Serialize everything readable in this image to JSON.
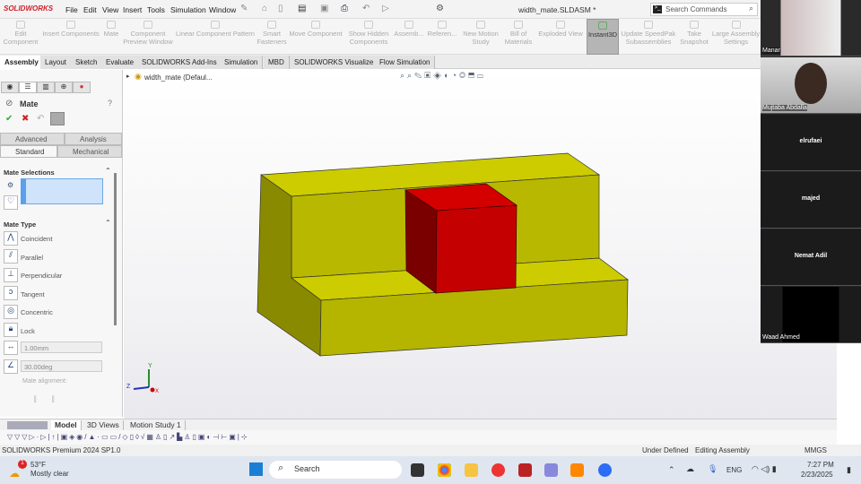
{
  "app": {
    "logo": "SOLIDWORKS",
    "document_title": "width_mate.SLDASM *",
    "search_placeholder": "Search Commands"
  },
  "menu": [
    "File",
    "Edit",
    "View",
    "Insert",
    "Tools",
    "Simulation",
    "Window"
  ],
  "ribbon": [
    {
      "label": "Edit Component"
    },
    {
      "label": "Insert Components"
    },
    {
      "label": "Mate"
    },
    {
      "label": "Component Preview Window"
    },
    {
      "label": "Linear Component Pattern"
    },
    {
      "label": "Smart Fasteners"
    },
    {
      "label": "Move Component"
    },
    {
      "label": "Show Hidden Components"
    },
    {
      "label": "Assemb..."
    },
    {
      "label": "Referen..."
    },
    {
      "label": "New Motion Study"
    },
    {
      "label": "Bill of Materials"
    },
    {
      "label": "Exploded View"
    },
    {
      "label": "Instant3D"
    },
    {
      "label": "Update SpeedPak Subassemblies"
    },
    {
      "label": "Take Snapshot"
    },
    {
      "label": "Large Assembly Settings"
    }
  ],
  "tabs": [
    "Assembly",
    "Layout",
    "Sketch",
    "Evaluate",
    "SOLIDWORKS Add-Ins",
    "Simulation",
    "MBD",
    "SOLIDWORKS Visualize",
    "Flow Simulation"
  ],
  "panel": {
    "title": "Mate",
    "subtabs": {
      "advanced": "Advanced",
      "analysis": "Analysis",
      "standard": "Standard",
      "mechanical": "Mechanical"
    },
    "mate_selections": "Mate Selections",
    "mate_type": "Mate Type",
    "types": [
      "Coincident",
      "Parallel",
      "Perpendicular",
      "Tangent",
      "Concentric",
      "Lock"
    ],
    "distance": "1.00mm",
    "angle": "30.00deg",
    "alignment": "Mate alignment:"
  },
  "tree": {
    "root": "width_mate (Defaul..."
  },
  "triad": {
    "x": "X",
    "y": "Y",
    "z": "Z"
  },
  "bottom_tabs": [
    "Model",
    "3D Views",
    "Motion Study 1"
  ],
  "status": {
    "product": "SOLIDWORKS Premium 2024 SP1.0",
    "state": "Under Defined",
    "mode": "Editing Assembly",
    "units": "MMGS"
  },
  "taskbar": {
    "weather_temp": "53°F",
    "weather_desc": "Mostly clear",
    "badge": "1",
    "search": "Search",
    "lang": "ENG",
    "time": "7:27 PM",
    "date": "2/23/2025"
  },
  "participants": [
    "Manar",
    "Mujtaba Abdalla",
    "elrufaei",
    "majed",
    "Nemat Adil",
    "Waad Ahmed"
  ],
  "colors": {
    "yellow": "#c8c800",
    "red": "#cc0000",
    "accent": "#d0202a"
  }
}
